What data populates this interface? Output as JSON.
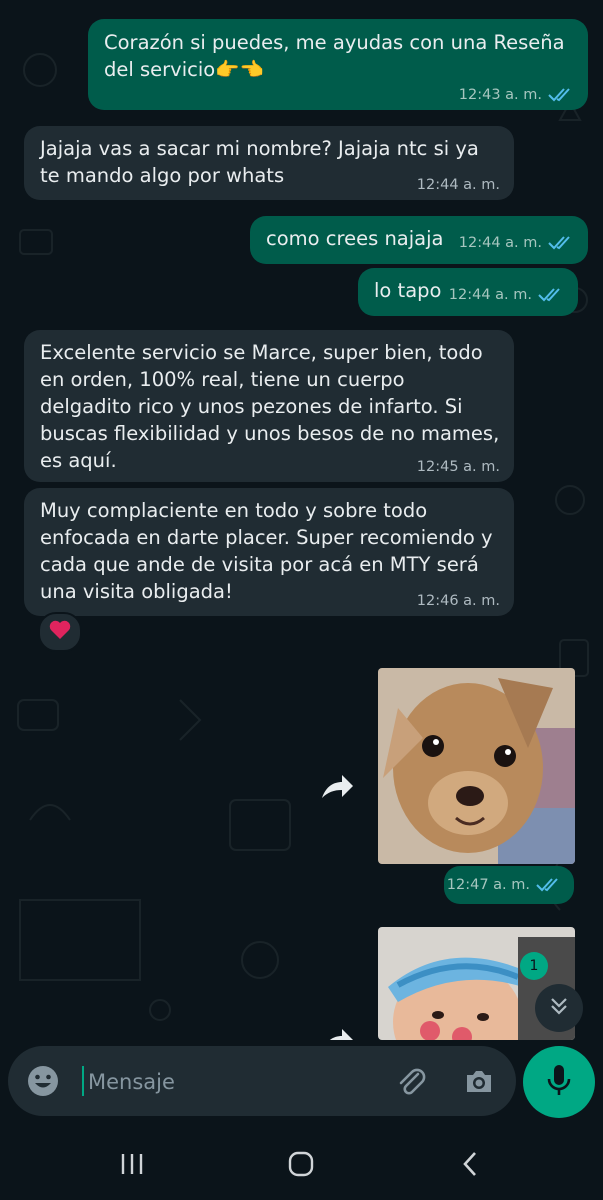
{
  "messages": [
    {
      "type": "out",
      "text": "Corazón si puedes, me  ayudas con una Reseña del servicio👉👈",
      "time": "12:43 a. m."
    },
    {
      "type": "in",
      "text": "Jajaja vas a sacar mi nombre? Jajaja ntc si ya te mando algo por whats",
      "time": "12:44 a. m."
    },
    {
      "type": "out",
      "text": "como crees najaja",
      "time": "12:44 a. m."
    },
    {
      "type": "out",
      "text": "lo tapo",
      "time": "12:44 a. m."
    },
    {
      "type": "in",
      "text": "Excelente servicio se Marce, super bien, todo en orden, 100% real, tiene un cuerpo delgadito rico y unos pezones de infarto. Si buscas flexibilidad y unos besos de no mames, es aquí.",
      "time": "12:45 a. m."
    },
    {
      "type": "in",
      "text": "Muy complaciente en todo y sobre todo enfocada en darte placer. Super recomiendo y cada que ande de visita por acá en MTY será una visita obligada!",
      "time": "12:46 a. m."
    },
    {
      "type": "out-media",
      "media": "puppy-photo",
      "time": "12:47 a. m."
    },
    {
      "type": "out-media",
      "media": "child-with-visor-photo",
      "time": ""
    }
  ],
  "reaction": {
    "emoji": "❤️",
    "icon": "heart-icon"
  },
  "unread_count": "1",
  "composer": {
    "placeholder": "Mensaje"
  },
  "colors": {
    "background": "#0b141a",
    "outgoing": "#005c4b",
    "incoming": "#202c33",
    "accent": "#00a884",
    "read_ticks": "#53bdeb"
  }
}
